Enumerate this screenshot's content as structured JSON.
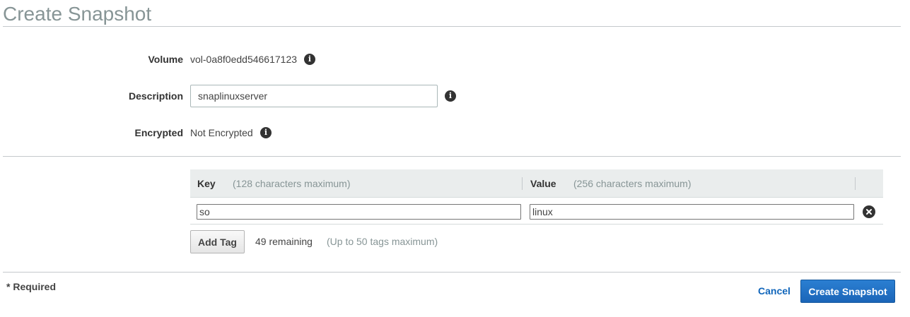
{
  "page": {
    "title": "Create Snapshot"
  },
  "form": {
    "volume_label": "Volume",
    "volume_value": "vol-0a8f0edd546617123",
    "description_label": "Description",
    "description_value": "snaplinuxserver",
    "encrypted_label": "Encrypted",
    "encrypted_value": "Not Encrypted"
  },
  "tags": {
    "key_header": "Key",
    "key_hint": "(128 characters maximum)",
    "value_header": "Value",
    "value_hint": "(256 characters maximum)",
    "rows": [
      {
        "key": "so",
        "value": "linux"
      }
    ],
    "add_tag_label": "Add Tag",
    "remaining_text": "49 remaining",
    "max_text": "(Up to 50 tags maximum)"
  },
  "footer": {
    "required_text": "* Required",
    "cancel_label": "Cancel",
    "submit_label": "Create Snapshot"
  },
  "icons": {
    "info": "info-icon",
    "remove": "remove-tag-icon"
  },
  "colors": {
    "primary": "#1b65b8",
    "link": "#1166bb",
    "title": "#879596"
  }
}
